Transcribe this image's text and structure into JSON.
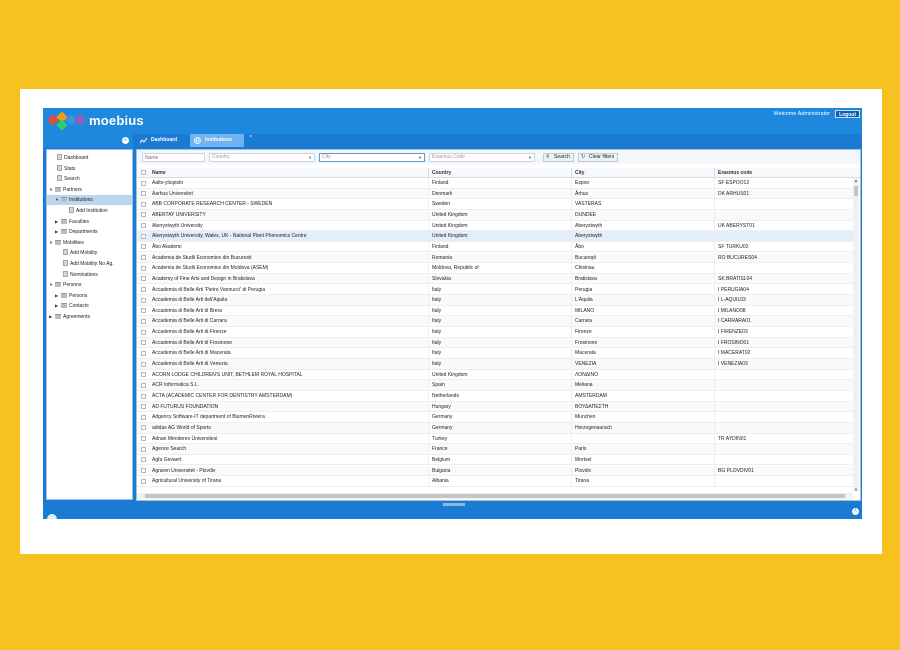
{
  "app": {
    "brand": "moebius",
    "brand_sub": "",
    "welcome": "Welcome Administrator",
    "logout_label": "Logout",
    "colors": {
      "header": "#1e88df",
      "accent": "#1b7ad1",
      "background": "#f5c21f"
    }
  },
  "sidebar": {
    "items": [
      {
        "label": "Dashboard",
        "icon": "page-icon"
      },
      {
        "label": "Stats",
        "icon": "page-icon"
      },
      {
        "label": "Search",
        "icon": "page-icon"
      },
      {
        "label": "Partners",
        "icon": "folder-icon",
        "expanded": true
      },
      {
        "label": "Institutions",
        "icon": "folder-icon",
        "expanded": true,
        "selected": true
      },
      {
        "label": "Add Institution",
        "icon": "page-icon"
      },
      {
        "label": "Faculties",
        "icon": "folder-icon",
        "expanded": false
      },
      {
        "label": "Departments",
        "icon": "folder-icon",
        "expanded": false
      },
      {
        "label": "Mobilities",
        "icon": "folder-icon",
        "expanded": true
      },
      {
        "label": "Add Mobility",
        "icon": "page-icon"
      },
      {
        "label": "Add Mobility No Ag.",
        "icon": "page-icon"
      },
      {
        "label": "Nominations",
        "icon": "page-icon"
      },
      {
        "label": "Persons",
        "icon": "folder-icon",
        "expanded": true
      },
      {
        "label": "Persons",
        "icon": "folder-icon",
        "expanded": false
      },
      {
        "label": "Contacts",
        "icon": "folder-icon",
        "expanded": false
      },
      {
        "label": "Agreements",
        "icon": "folder-icon",
        "expanded": false
      }
    ]
  },
  "tabs": [
    {
      "label": "Dashboard",
      "icon": "chart-icon"
    },
    {
      "label": "Institutions",
      "icon": "globe-icon",
      "active": true
    }
  ],
  "filters": {
    "name_placeholder": "Name",
    "country_placeholder": "Country",
    "city_placeholder": "City",
    "erasmus_placeholder": "Erasmus Code",
    "search_label": "Search",
    "clear_label": "Clear filters"
  },
  "columns": [
    "Name",
    "Country",
    "City",
    "Erasmus code"
  ],
  "rows": [
    [
      "Aalto-yliopisto",
      "Finland",
      "Espoo",
      "SF ESPOO12"
    ],
    [
      "Aarhus Universitet",
      "Denmark",
      "Århus",
      "DK ARHUS01"
    ],
    [
      "ABB CORPORATE RESEARCH CENTER - SWEDEN",
      "Sweden",
      "VASTERAS",
      ""
    ],
    [
      "ABERTAY UNIVERSITY",
      "United Kingdom",
      "DUNDEE",
      ""
    ],
    [
      "Aberystwyth University",
      "United Kingdom",
      "Aberystwyth",
      "UK ABERYST01"
    ],
    [
      "Aberystwyth University, Wales, UK - National Plant Phenomics Centre",
      "United Kingdom",
      "Aberystwyth",
      ""
    ],
    [
      "Åbo Akademi",
      "Finland",
      "Åbo",
      "SF TURKU02"
    ],
    [
      "Academia de Studii Economice din Bucuresti",
      "Romania",
      "Bucureşti",
      "RO BUCURES04"
    ],
    [
      "Academia de Studii Economice din Moldova (ASEM)",
      "Moldova, Republic of",
      "Chisinau",
      ""
    ],
    [
      "Academy of Fine Arts and Design in Bratislava",
      "Slovakia",
      "Bratislava",
      "SK BRATISL04"
    ],
    [
      "Accademia di Belle Arti 'Pietro Vannucci' di Perugia",
      "Italy",
      "Perugia",
      "I PERUGIA04"
    ],
    [
      "Accademia di Belle Arti dell'Aquila",
      "Italy",
      "L'Aquila",
      "I L-AQUIL03"
    ],
    [
      "Accademia di Belle Arti di Brera",
      "Italy",
      "MILANO",
      "I MILANO08"
    ],
    [
      "Accademia di Belle Arti di Carrara",
      "Italy",
      "Carrara",
      "I CARRARA01"
    ],
    [
      "Accademia di Belle Arti di Firenze",
      "Italy",
      "Firenze",
      "I FIRENZE03"
    ],
    [
      "Accademia di Belle Arti di Frosinone",
      "Italy",
      "Frosinone",
      "I FROSINO01"
    ],
    [
      "Accademia di Belle Arti di Macerata",
      "Italy",
      "Macerata",
      "I MACERAT02"
    ],
    [
      "Accademia di Belle Arti di Venezia",
      "Italy",
      "VENEZIA",
      "I VENEZIA03"
    ],
    [
      "ACORN LODGE CHILDREN'S UNIT, BETHLEM ROYAL HOSPITAL",
      "United Kingdom",
      "ΛΟΝΔΙΝΟ",
      ""
    ],
    [
      "ACR Informatica S.L.",
      "Spain",
      "Meliana",
      ""
    ],
    [
      "ACTA (ACADEMIC CENTER FOR DENTISTRY AMSTERDAM)",
      "Netherlands",
      "AMSTERDAM",
      ""
    ],
    [
      "AD FUTURUS FOUNDATION",
      "Hungary",
      "ΒΟΥΔΑΠΕΣΤΗ",
      ""
    ],
    [
      "Adgency Software-IT department of BlumenRiviera",
      "Germany",
      "Munchen",
      ""
    ],
    [
      "adidas AG World of Sports",
      "Germany",
      "Herzogenaurach",
      ""
    ],
    [
      "Adnan Menderes Üniversitesi",
      "Turkey",
      "",
      "TR AYDIN01"
    ],
    [
      "Agence Search",
      "France",
      "Paris",
      ""
    ],
    [
      "Agfa Gevaert",
      "Belgium",
      "Mortsel",
      ""
    ],
    [
      "Agraren Universitet - Plovdiv",
      "Bulgaria",
      "Plovdiv",
      "BG PLOVDIV01"
    ],
    [
      "Agricultural University of Tirana",
      "Albania",
      "Tirana",
      ""
    ]
  ],
  "selected_row_index": 5
}
